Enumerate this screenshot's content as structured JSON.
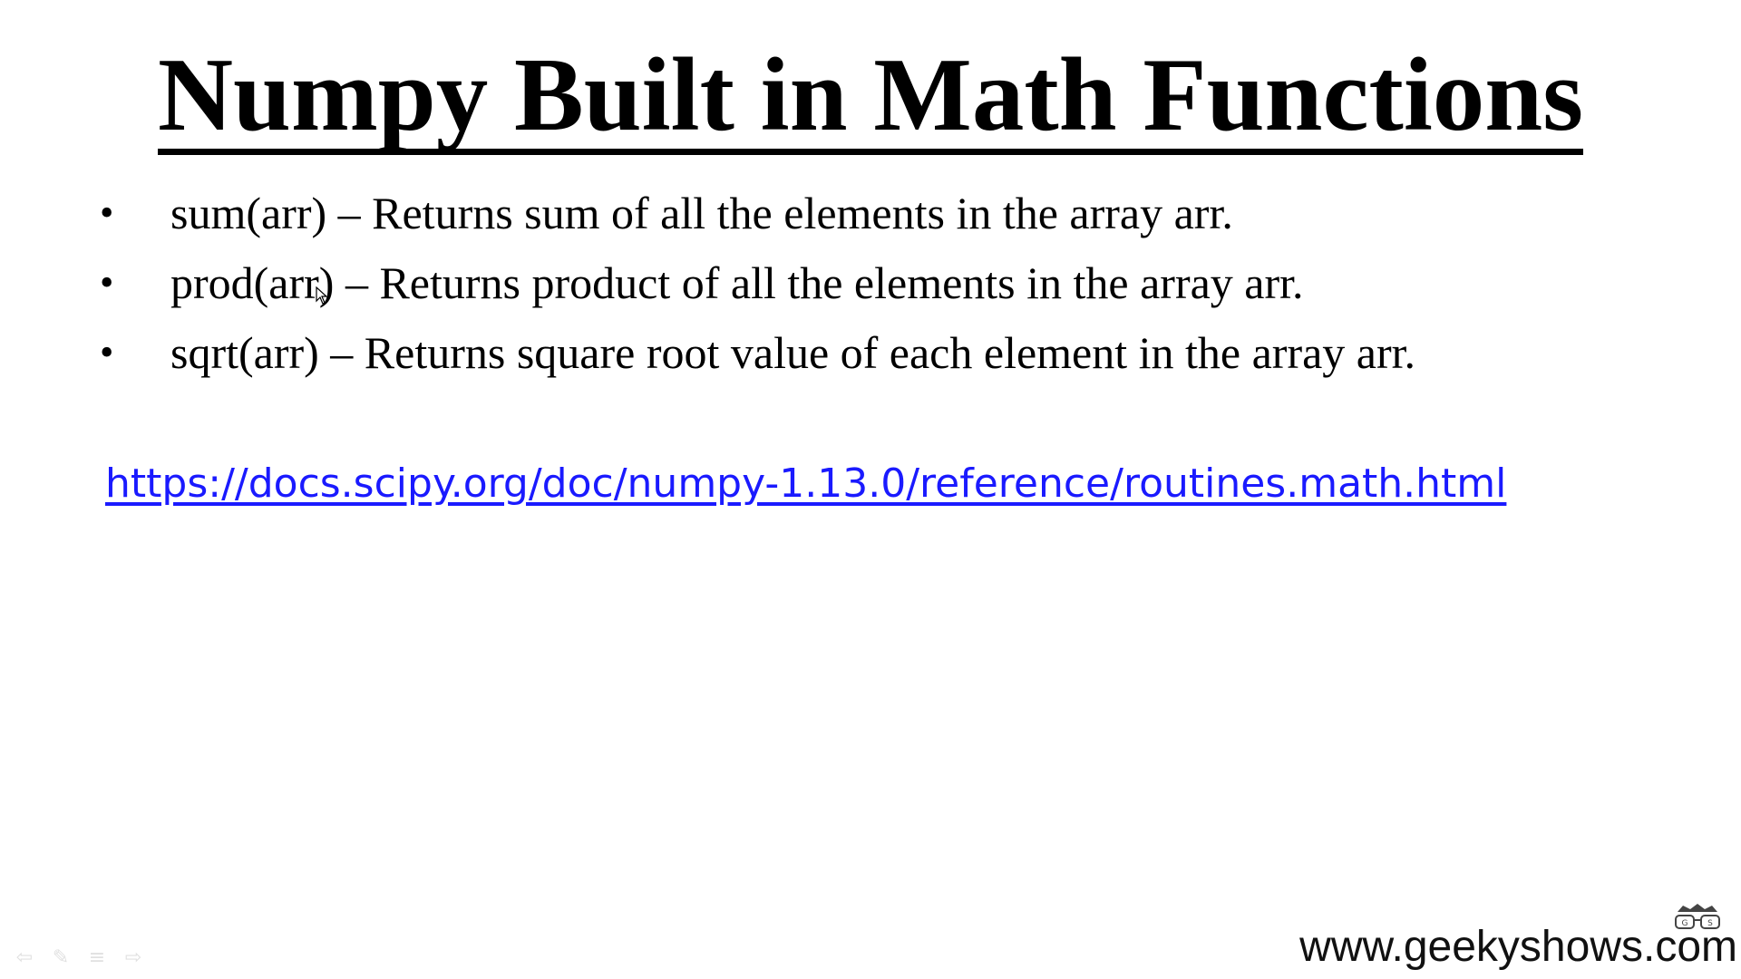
{
  "slide": {
    "title": "Numpy Built in Math Functions",
    "bullet_symbol": "•",
    "bullets": [
      "sum(arr) – Returns sum of all the elements in the array arr.",
      "prod(arr) – Returns product of all the elements in the array arr.",
      "sqrt(arr) – Returns square root value of each element in the array arr."
    ],
    "link": "https://docs.scipy.org/doc/numpy-1.13.0/reference/routines.math.html",
    "watermark": "www.geekyshows.com"
  },
  "icons": {
    "nav": [
      "previous-slide-icon",
      "pen-icon",
      "menu-icon",
      "next-slide-icon"
    ],
    "logo": "glasses-icon",
    "pointer": "mouse-pointer-icon"
  },
  "colors": {
    "text": "#000000",
    "link": "#1a1aff",
    "background": "#ffffff"
  }
}
